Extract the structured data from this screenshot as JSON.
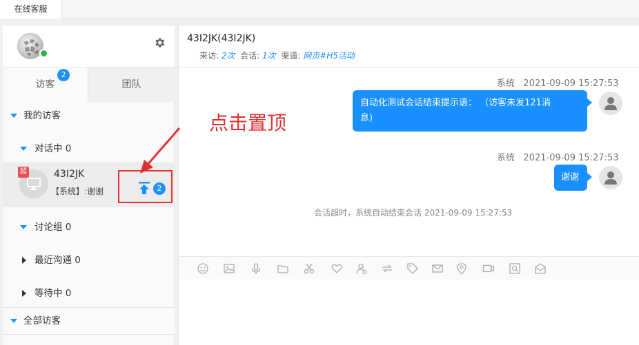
{
  "top_tab": "在线客服",
  "sidebar": {
    "tabs": [
      {
        "label": "访客",
        "badge": "2"
      },
      {
        "label": "团队"
      }
    ],
    "groups": {
      "my_visitors": "我的访客",
      "in_conversation": "对话中 0",
      "discussion": "讨论组 0",
      "recent": "最近沟通 0",
      "waiting": "等待中 0",
      "all_visitors": "全部访客"
    },
    "conversation": {
      "vip": "超",
      "name": "43I2JK",
      "last_message": "【系统】:谢谢",
      "unread": "2"
    }
  },
  "chat": {
    "title": "43I2JK(43I2JK)",
    "meta": {
      "visits_label": "来访:",
      "visits_value": "2次",
      "sessions_label": "会话:",
      "sessions_value": "1次",
      "channel_label": "渠道:",
      "channel_value": "网页#H5活动"
    },
    "messages": [
      {
        "sender": "系统",
        "time": "2021-09-09 15:27:53",
        "text_line1": "自动化测试会话结束提示语： （访客未发121消",
        "text_line2": "息)"
      },
      {
        "sender": "系统",
        "time": "2021-09-09 15:27:53",
        "text": "谢谢"
      }
    ],
    "timeout_notice": "会话超时，系统自动结束会话  2021-09-09 15:27:53"
  },
  "annotation": "点击置顶",
  "colors": {
    "accent": "#1890ff",
    "highlight": "#e03131",
    "online": "#2bb24c"
  }
}
